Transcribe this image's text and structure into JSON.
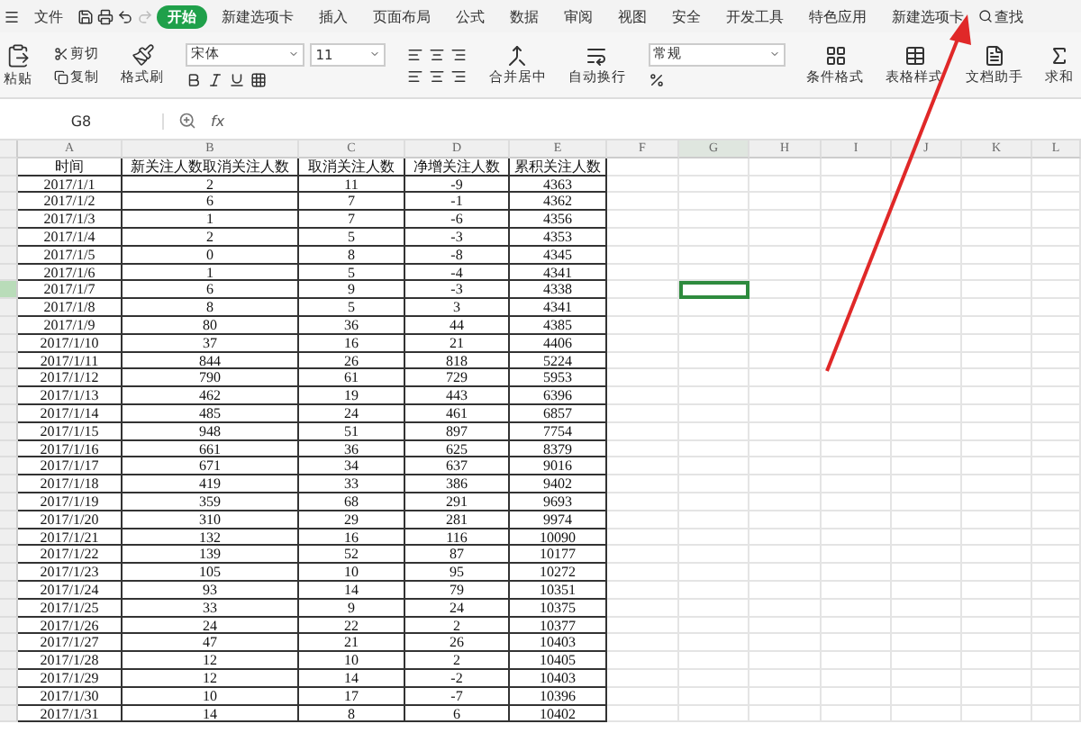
{
  "menu": {
    "file": "文件",
    "tabs": [
      {
        "label": "开始",
        "selected": true
      },
      {
        "label": "新建选项卡",
        "selected": false
      },
      {
        "label": "插入",
        "selected": false
      },
      {
        "label": "页面布局",
        "selected": false
      },
      {
        "label": "公式",
        "selected": false
      },
      {
        "label": "数据",
        "selected": false
      },
      {
        "label": "审阅",
        "selected": false
      },
      {
        "label": "视图",
        "selected": false
      },
      {
        "label": "安全",
        "selected": false
      },
      {
        "label": "开发工具",
        "selected": false
      },
      {
        "label": "特色应用",
        "selected": false
      },
      {
        "label": "新建选项卡",
        "selected": false
      }
    ],
    "search": "查找"
  },
  "ribbon": {
    "paste": "粘贴",
    "cut": "剪切",
    "copy": "复制",
    "format_painter": "格式刷",
    "font": "宋体",
    "font_size": "11",
    "merge": "合并居中",
    "wrap": "自动换行",
    "number_format": "常规",
    "conditional": "条件格式",
    "table_style": "表格样式",
    "doc_helper": "文档助手",
    "sum": "求和"
  },
  "formula_bar": {
    "name_box": "G8",
    "fx": "fx"
  },
  "sheet": {
    "columns": [
      {
        "label": "A",
        "selected": false
      },
      {
        "label": "B",
        "selected": false
      },
      {
        "label": "C",
        "selected": false
      },
      {
        "label": "D",
        "selected": false
      },
      {
        "label": "E",
        "selected": false
      },
      {
        "label": "F",
        "selected": false
      },
      {
        "label": "G",
        "selected": true
      },
      {
        "label": "H",
        "selected": false
      },
      {
        "label": "I",
        "selected": false
      },
      {
        "label": "J",
        "selected": false
      },
      {
        "label": "K",
        "selected": false
      },
      {
        "label": "L",
        "selected": false
      }
    ],
    "rows": [
      {
        "cells": [
          "时间",
          "新关注人数取消关注人数",
          "取消关注人数",
          "净增关注人数",
          "累积关注人数"
        ],
        "selected": false
      },
      {
        "cells": [
          "2017/1/1",
          "2",
          "11",
          "-9",
          "4363"
        ],
        "selected": false
      },
      {
        "cells": [
          "2017/1/2",
          "6",
          "7",
          "-1",
          "4362"
        ],
        "selected": false
      },
      {
        "cells": [
          "2017/1/3",
          "1",
          "7",
          "-6",
          "4356"
        ],
        "selected": false
      },
      {
        "cells": [
          "2017/1/4",
          "2",
          "5",
          "-3",
          "4353"
        ],
        "selected": false
      },
      {
        "cells": [
          "2017/1/5",
          "0",
          "8",
          "-8",
          "4345"
        ],
        "selected": false
      },
      {
        "cells": [
          "2017/1/6",
          "1",
          "5",
          "-4",
          "4341"
        ],
        "selected": false
      },
      {
        "cells": [
          "2017/1/7",
          "6",
          "9",
          "-3",
          "4338"
        ],
        "selected": true
      },
      {
        "cells": [
          "2017/1/8",
          "8",
          "5",
          "3",
          "4341"
        ],
        "selected": false
      },
      {
        "cells": [
          "2017/1/9",
          "80",
          "36",
          "44",
          "4385"
        ],
        "selected": false
      },
      {
        "cells": [
          "2017/1/10",
          "37",
          "16",
          "21",
          "4406"
        ],
        "selected": false
      },
      {
        "cells": [
          "2017/1/11",
          "844",
          "26",
          "818",
          "5224"
        ],
        "selected": false
      },
      {
        "cells": [
          "2017/1/12",
          "790",
          "61",
          "729",
          "5953"
        ],
        "selected": false
      },
      {
        "cells": [
          "2017/1/13",
          "462",
          "19",
          "443",
          "6396"
        ],
        "selected": false
      },
      {
        "cells": [
          "2017/1/14",
          "485",
          "24",
          "461",
          "6857"
        ],
        "selected": false
      },
      {
        "cells": [
          "2017/1/15",
          "948",
          "51",
          "897",
          "7754"
        ],
        "selected": false
      },
      {
        "cells": [
          "2017/1/16",
          "661",
          "36",
          "625",
          "8379"
        ],
        "selected": false
      },
      {
        "cells": [
          "2017/1/17",
          "671",
          "34",
          "637",
          "9016"
        ],
        "selected": false
      },
      {
        "cells": [
          "2017/1/18",
          "419",
          "33",
          "386",
          "9402"
        ],
        "selected": false
      },
      {
        "cells": [
          "2017/1/19",
          "359",
          "68",
          "291",
          "9693"
        ],
        "selected": false
      },
      {
        "cells": [
          "2017/1/20",
          "310",
          "29",
          "281",
          "9974"
        ],
        "selected": false
      },
      {
        "cells": [
          "2017/1/21",
          "132",
          "16",
          "116",
          "10090"
        ],
        "selected": false
      },
      {
        "cells": [
          "2017/1/22",
          "139",
          "52",
          "87",
          "10177"
        ],
        "selected": false
      },
      {
        "cells": [
          "2017/1/23",
          "105",
          "10",
          "95",
          "10272"
        ],
        "selected": false
      },
      {
        "cells": [
          "2017/1/24",
          "93",
          "14",
          "79",
          "10351"
        ],
        "selected": false
      },
      {
        "cells": [
          "2017/1/25",
          "33",
          "9",
          "24",
          "10375"
        ],
        "selected": false
      },
      {
        "cells": [
          "2017/1/26",
          "24",
          "22",
          "2",
          "10377"
        ],
        "selected": false
      },
      {
        "cells": [
          "2017/1/27",
          "47",
          "21",
          "26",
          "10403"
        ],
        "selected": false
      },
      {
        "cells": [
          "2017/1/28",
          "12",
          "10",
          "2",
          "10405"
        ],
        "selected": false
      },
      {
        "cells": [
          "2017/1/29",
          "12",
          "14",
          "-2",
          "10403"
        ],
        "selected": false
      },
      {
        "cells": [
          "2017/1/30",
          "10",
          "17",
          "-7",
          "10396"
        ],
        "selected": false
      },
      {
        "cells": [
          "2017/1/31",
          "14",
          "8",
          "6",
          "10402"
        ],
        "selected": false
      }
    ]
  }
}
